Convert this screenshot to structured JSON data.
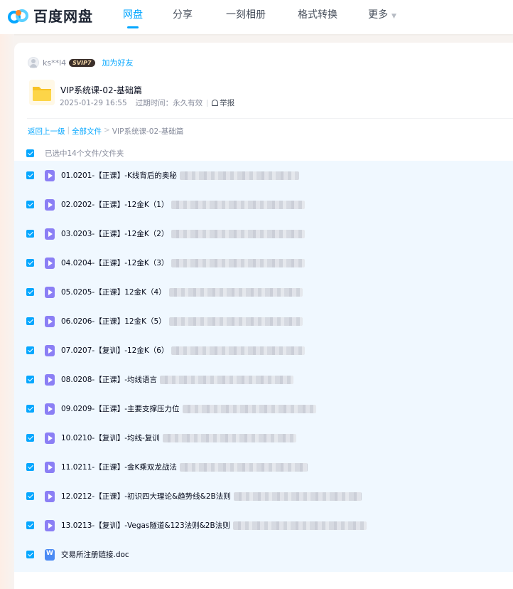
{
  "app": {
    "logo_text": "百度网盘",
    "accent_color": "#06a7ff"
  },
  "nav": {
    "items": [
      {
        "label": "网盘",
        "active": true
      },
      {
        "label": "分享",
        "active": false
      },
      {
        "label": "一刻相册",
        "active": false
      },
      {
        "label": "格式转换",
        "active": false
      },
      {
        "label": "更多",
        "active": false
      }
    ]
  },
  "share": {
    "sharer_name": "ks**l4",
    "vip_badge": "SVIP7",
    "add_friend": "加为好友",
    "folder_title": "VIP系统课-02-基础篇",
    "created": "2025-01-29 16:55",
    "expiry": "过期时间：永久有效",
    "report": "举报"
  },
  "breadcrumb": {
    "back": "返回上一级",
    "all_files": "全部文件",
    "sep": ">",
    "current": "VIP系统课-02-基础篇",
    "pipe": "|"
  },
  "selection": {
    "label": "已选中14个文件/文件夹"
  },
  "files": [
    {
      "name": "01.0201-【正课】-K线背后的奥秘",
      "type": "video"
    },
    {
      "name": "02.0202-【正课】-12金K（1）",
      "type": "video"
    },
    {
      "name": "03.0203-【正课】-12金K（2）",
      "type": "video"
    },
    {
      "name": "04.0204-【正课】-12金K（3）",
      "type": "video"
    },
    {
      "name": "05.0205-【正课】12金K（4）",
      "type": "video"
    },
    {
      "name": "06.0206-【正课】12金K（5）",
      "type": "video"
    },
    {
      "name": "07.0207-【复训】-12金K（6）",
      "type": "video"
    },
    {
      "name": "08.0208-【正课】-均线语言",
      "type": "video"
    },
    {
      "name": "09.0209-【正课】-主要支撑压力位",
      "type": "video"
    },
    {
      "name": "10.0210-【复训】-均线-复训",
      "type": "video"
    },
    {
      "name": "11.0211-【正课】-金K乘双龙战法",
      "type": "video"
    },
    {
      "name": "12.0212-【正课】-初识四大理论&趋势线&2B法则",
      "type": "video"
    },
    {
      "name": "13.0213-【复训】-Vegas隧道&123法则&2B法则",
      "type": "video"
    },
    {
      "name": "交易所注册链接.doc",
      "type": "doc"
    }
  ]
}
